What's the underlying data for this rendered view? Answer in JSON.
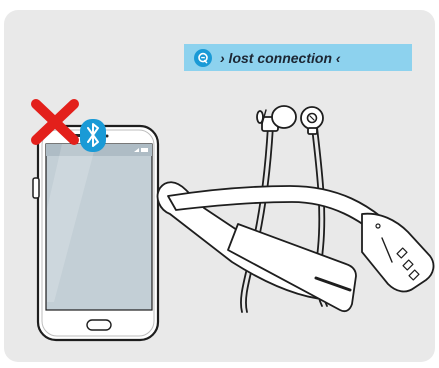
{
  "status_banner": {
    "text": "› lost connection ‹",
    "icon": "speech-bubble-icon",
    "background": "#8dd2ee",
    "icon_color": "#1a9ad6"
  },
  "phone": {
    "bluetooth_icon": "bluetooth-icon",
    "bluetooth_color": "#1a9ad6",
    "disconnected_mark": "red-x-icon",
    "disconnected_color": "#e3201b"
  },
  "headset": {
    "icon": "neckband-headphones-icon"
  }
}
